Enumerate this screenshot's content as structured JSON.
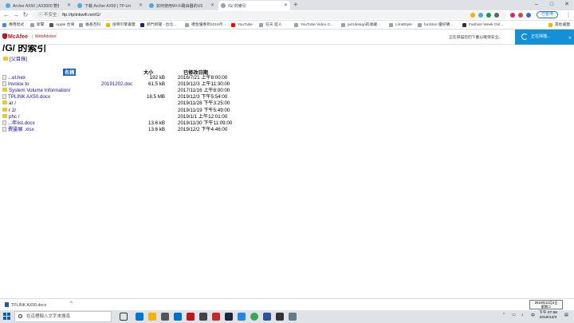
{
  "tabs": [
    {
      "label": "Archer AX50 | AX3000 雙頻 Gi..."
    },
    {
      "label": "下載 Archer AX50 | TP-Link 臺灣"
    },
    {
      "label": "如何使用Wi-Fi路由器的USB共享"
    },
    {
      "label": "/G/ 的索引"
    }
  ],
  "window": {
    "new_tab": "+",
    "minimize": "–",
    "maximize": "□",
    "close": "✕"
  },
  "address": {
    "security": "不安全",
    "url": "ftp://tplinkwifi.net/G/"
  },
  "profile": {
    "label": "已暫停"
  },
  "bookmarks": [
    {
      "label": "應用程式"
    },
    {
      "label": "新聞"
    },
    {
      "label": "Apple 台灣"
    },
    {
      "label": "維基百科"
    },
    {
      "label": "搜尋引擎書籤"
    },
    {
      "label": "熱門新聞 - 台北..."
    },
    {
      "label": "禮金優惠到2016月..."
    },
    {
      "label": "YouTube"
    },
    {
      "label": "任天 遊人"
    },
    {
      "label": "YouTube Video C..."
    },
    {
      "label": "jazzdesign的收藏..."
    },
    {
      "label": "LimitStyle"
    },
    {
      "label": "funStoo 優好購..."
    },
    {
      "label": "Fashion Week Onl..."
    },
    {
      "label": "其他書籤"
    }
  ],
  "mcafee": {
    "brand": "McAfee",
    "product": "WebAdvisor",
    "message": "正在掃描您的下載以確保安全。",
    "button": "正在掃描...",
    "close": "✕"
  },
  "listing": {
    "title": "/G/ 的索引",
    "parent_link": "[父目錄]",
    "headers": {
      "name": "名稱",
      "size": "大小",
      "date": "已修改日期"
    },
    "rows": [
      {
        "type": "file",
        "name": "...et.hex",
        "name2": "",
        "size": "192 kB",
        "date": "2016/7/21 上午8:00:00"
      },
      {
        "type": "file",
        "name": "Invoice to",
        "name2": "20191202.doc",
        "size": "61.5 kB",
        "date": "2019/12/3 上午11:30:00"
      },
      {
        "type": "folder",
        "name": "System Volume Information/",
        "name2": "",
        "size": "",
        "date": "2017/11/16 上午8:00:00"
      },
      {
        "type": "file",
        "name": "TPLINK AX50.docx",
        "name2": "",
        "size": "18.5 MB",
        "date": "2019/12/3 下午5:54:00"
      },
      {
        "type": "folder",
        "name": "ar     /",
        "name2": "",
        "size": "",
        "date": "2019/11/28 下午3:25:00"
      },
      {
        "type": "folder",
        "name": "r         2/",
        "name2": "",
        "size": "",
        "date": "2019/11/19 下午5:49:00"
      },
      {
        "type": "folder",
        "name": "phc     /",
        "name2": "",
        "size": "",
        "date": "2019/1/1 上午12:01:00"
      },
      {
        "type": "file",
        "name": "...年list.docx",
        "name2": "",
        "size": "13.6 kB",
        "date": "2019/11/30 下午11:09:00"
      },
      {
        "type": "file",
        "name": "費靈展         .xlsx",
        "name2": "",
        "size": "13.6 kB",
        "date": "2019/12/2 下午4:46:00"
      }
    ]
  },
  "downloads": {
    "item": "TPLINK AX50.docx",
    "chevron": "^"
  },
  "tooltip": {
    "line1": "2019年12月3日",
    "line2": "星期二"
  },
  "taskbar": {
    "search_placeholder": "在這裡輸入文字來搜尋",
    "lang": "中",
    "time": "下午 07:58",
    "date": "2019/12/3"
  },
  "colors": {
    "mcafee_red": "#c01818",
    "mcafee_blue": "#1390d6",
    "link": "#1a0dab",
    "selection": "#1a5fd0"
  }
}
